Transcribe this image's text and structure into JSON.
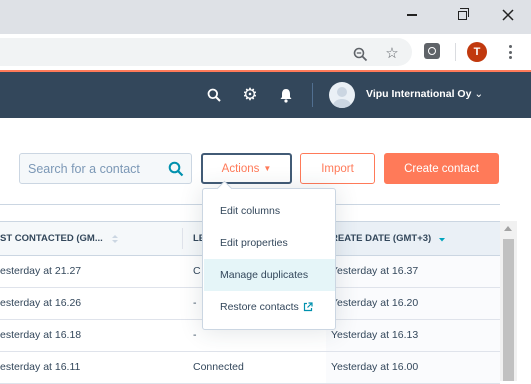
{
  "browser": {
    "profile_initial": "T"
  },
  "nav": {
    "account_name": "Vipu International Oy",
    "chevron": "⌄"
  },
  "toolbar": {
    "search_placeholder": "Search for a contact",
    "actions_label": "Actions",
    "actions_caret": "▼",
    "import_label": "Import",
    "create_label": "Create contact"
  },
  "table": {
    "columns": [
      "ST CONTACTED (GM...",
      "LE",
      "REATE DATE (GMT+3)"
    ],
    "rows": [
      {
        "last_contacted": "esterday at 21.27",
        "lead_status": "C",
        "create_date": "Yesterday at 16.37"
      },
      {
        "last_contacted": "esterday at 16.26",
        "lead_status": "-",
        "create_date": "Yesterday at 16.20"
      },
      {
        "last_contacted": "esterday at 16.18",
        "lead_status": "-",
        "create_date": "Yesterday at 16.13"
      },
      {
        "last_contacted": "esterday at 16.11",
        "lead_status": "Connected",
        "create_date": "Yesterday at 16.00"
      }
    ]
  },
  "menu": {
    "items": [
      "Edit columns",
      "Edit properties",
      "Manage duplicates",
      "Restore contacts"
    ]
  },
  "colors": {
    "nav_bg": "#33475b",
    "accent": "#ff7a59",
    "hover_row": "#e5f5f8",
    "sort_active": "#00a4bd"
  }
}
